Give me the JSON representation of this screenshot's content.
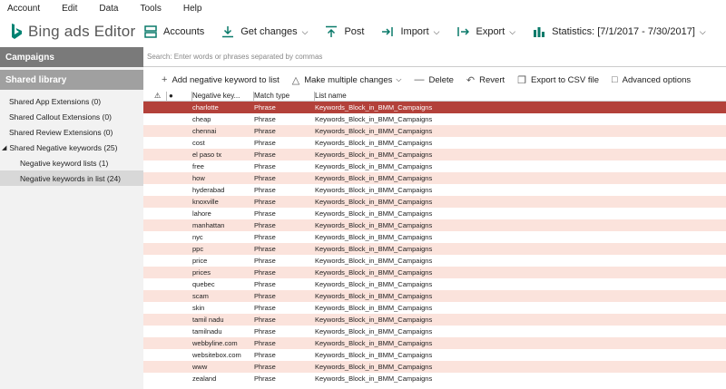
{
  "menu": {
    "items": [
      "Account",
      "Edit",
      "Data",
      "Tools",
      "Help"
    ]
  },
  "app": {
    "brand": "Bing",
    "title": "ads Editor"
  },
  "toolbar": {
    "accounts": "Accounts",
    "get_changes": "Get changes",
    "post": "Post",
    "import": "Import",
    "export": "Export",
    "statistics": "Statistics: [7/1/2017 - 7/30/2017]"
  },
  "sidebar": {
    "campaigns_header": "Campaigns",
    "shared_header": "Shared library",
    "items": [
      "Shared App Extensions (0)",
      "Shared Callout Extensions (0)",
      "Shared Review Extensions (0)",
      "Shared Negative keywords (25)",
      "Negative keyword lists (1)",
      "Negative keywords in list (24)"
    ]
  },
  "search": {
    "placeholder": "Search: Enter words or phrases separated by commas"
  },
  "actions": {
    "add": "Add negative keyword to list",
    "multiple": "Make multiple changes",
    "delete": "Delete",
    "revert": "Revert",
    "export_csv": "Export to CSV file",
    "advanced": "Advanced options"
  },
  "grid": {
    "headers": {
      "keyword": "Negative key...",
      "match": "Match type",
      "list": "List name"
    },
    "rows": [
      {
        "keyword": "charlotte",
        "match": "Phrase",
        "list": "Keywords_Block_in_BMM_Campaigns"
      },
      {
        "keyword": "cheap",
        "match": "Phrase",
        "list": "Keywords_Block_in_BMM_Campaigns"
      },
      {
        "keyword": "chennai",
        "match": "Phrase",
        "list": "Keywords_Block_in_BMM_Campaigns"
      },
      {
        "keyword": "cost",
        "match": "Phrase",
        "list": "Keywords_Block_in_BMM_Campaigns"
      },
      {
        "keyword": "el paso tx",
        "match": "Phrase",
        "list": "Keywords_Block_in_BMM_Campaigns"
      },
      {
        "keyword": "free",
        "match": "Phrase",
        "list": "Keywords_Block_in_BMM_Campaigns"
      },
      {
        "keyword": "how",
        "match": "Phrase",
        "list": "Keywords_Block_in_BMM_Campaigns"
      },
      {
        "keyword": "hyderabad",
        "match": "Phrase",
        "list": "Keywords_Block_in_BMM_Campaigns"
      },
      {
        "keyword": "knoxville",
        "match": "Phrase",
        "list": "Keywords_Block_in_BMM_Campaigns"
      },
      {
        "keyword": "lahore",
        "match": "Phrase",
        "list": "Keywords_Block_in_BMM_Campaigns"
      },
      {
        "keyword": "manhattan",
        "match": "Phrase",
        "list": "Keywords_Block_in_BMM_Campaigns"
      },
      {
        "keyword": "nyc",
        "match": "Phrase",
        "list": "Keywords_Block_in_BMM_Campaigns"
      },
      {
        "keyword": "ppc",
        "match": "Phrase",
        "list": "Keywords_Block_in_BMM_Campaigns"
      },
      {
        "keyword": "price",
        "match": "Phrase",
        "list": "Keywords_Block_in_BMM_Campaigns"
      },
      {
        "keyword": "prices",
        "match": "Phrase",
        "list": "Keywords_Block_in_BMM_Campaigns"
      },
      {
        "keyword": "quebec",
        "match": "Phrase",
        "list": "Keywords_Block_in_BMM_Campaigns"
      },
      {
        "keyword": "scam",
        "match": "Phrase",
        "list": "Keywords_Block_in_BMM_Campaigns"
      },
      {
        "keyword": "skin",
        "match": "Phrase",
        "list": "Keywords_Block_in_BMM_Campaigns"
      },
      {
        "keyword": "tamil nadu",
        "match": "Phrase",
        "list": "Keywords_Block_in_BMM_Campaigns"
      },
      {
        "keyword": "tamilnadu",
        "match": "Phrase",
        "list": "Keywords_Block_in_BMM_Campaigns"
      },
      {
        "keyword": "webbyline.com",
        "match": "Phrase",
        "list": "Keywords_Block_in_BMM_Campaigns"
      },
      {
        "keyword": "websitebox.com",
        "match": "Phrase",
        "list": "Keywords_Block_in_BMM_Campaigns"
      },
      {
        "keyword": "www",
        "match": "Phrase",
        "list": "Keywords_Block_in_BMM_Campaigns"
      },
      {
        "keyword": "zealand",
        "match": "Phrase",
        "list": "Keywords_Block_in_BMM_Campaigns"
      }
    ]
  },
  "colors": {
    "brand_teal": "#008373",
    "selected_row": "#b3413a",
    "stripe": "#fbe3dc",
    "sidebar_header": "#7a7a7a"
  }
}
